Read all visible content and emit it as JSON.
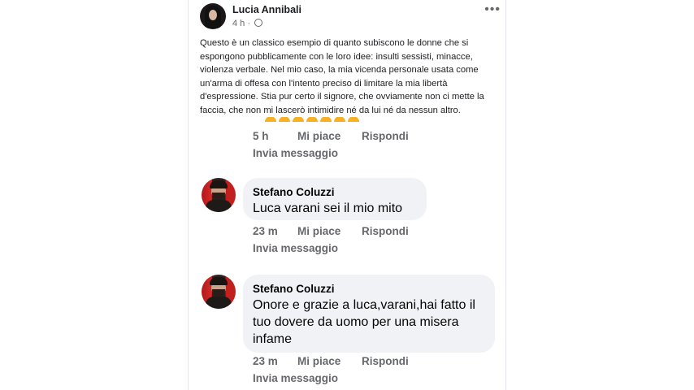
{
  "post": {
    "author": "Lucia Annibali",
    "time": "4 h · ",
    "more_icon": "more-horizontal-icon",
    "privacy_icon": "globe-icon",
    "text": "Questo è un classico esempio di quanto subiscono le donne che si espongono pubblicamente con le loro idee: insulti sessisti, minacce, violenza verbale. Nel mio caso, la mia vicenda personale usata come un'arma di offesa con l'intento preciso di limitare la mia libertà d'espressione. Stia pur certo il signore, che ovviamente non ci mette la faccia, che non mi lascerò intimidire né da lui né da nessun altro."
  },
  "first_comment_actions": {
    "time": "5 h",
    "like": "Mi piace",
    "reply": "Rispondi",
    "message": "Invia messaggio"
  },
  "comments": [
    {
      "author": "Stefano Coluzzi",
      "text": "Luca varani sei il mio mito",
      "time": "23 m",
      "like": "Mi piace",
      "reply": "Rispondi",
      "message": "Invia messaggio"
    },
    {
      "author": "Stefano Coluzzi",
      "text": "Onore e grazie a luca,varani,hai fatto il tuo dovere da uomo per una misera infame",
      "time": "23 m",
      "like": "Mi piace",
      "reply": "Rispondi",
      "message": "Invia messaggio"
    }
  ],
  "colors": {
    "bubble": "#f0f2f5",
    "meta": "#65676b",
    "text": "#050505"
  }
}
